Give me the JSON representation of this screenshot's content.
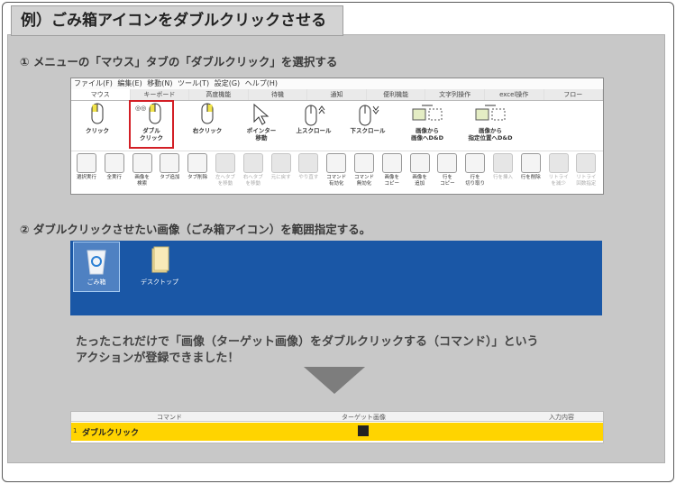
{
  "heading": "例）ごみ箱アイコンをダブルクリックさせる",
  "step1": "① メニューの「マウス」タブの「ダブルクリック」を選択する",
  "step2": "② ダブルクリックさせたい画像（ごみ箱アイコン）を範囲指定する。",
  "menubar": [
    "ファイル(F)",
    "編集(E)",
    "移動(N)",
    "ツール(T)",
    "設定(G)",
    "ヘルプ(H)"
  ],
  "tabs": [
    "マウス",
    "キーボード",
    "高度機能",
    "待機",
    "通知",
    "便利機能",
    "文字列操作",
    "excel操作",
    "フロー"
  ],
  "mouse_tools": [
    {
      "label": "クリック"
    },
    {
      "label": "ダブル\nクリック"
    },
    {
      "label": "右クリック"
    },
    {
      "label": "ポインター\n移動"
    },
    {
      "label": "上スクロール"
    },
    {
      "label": "下スクロール"
    },
    {
      "label": "画像から\n画像へD&D"
    },
    {
      "label": "画像から\n指定位置へD&D"
    }
  ],
  "toolbar2": [
    {
      "label": "選択実行",
      "disabled": false
    },
    {
      "label": "全実行",
      "disabled": false
    },
    {
      "label": "画像を\n検索",
      "disabled": false
    },
    {
      "label": "タブ追加",
      "disabled": false
    },
    {
      "label": "タブ削除",
      "disabled": false
    },
    {
      "label": "左へタブ\nを移動",
      "disabled": true
    },
    {
      "label": "右へタブ\nを移動",
      "disabled": true
    },
    {
      "label": "元に戻す",
      "disabled": true
    },
    {
      "label": "やり直す",
      "disabled": true
    },
    {
      "label": "コマンド\n有効化",
      "disabled": false
    },
    {
      "label": "コマンド\n無効化",
      "disabled": false
    },
    {
      "label": "画像を\nコピー",
      "disabled": false
    },
    {
      "label": "画像を\n追加",
      "disabled": false
    },
    {
      "label": "行を\nコピー",
      "disabled": false
    },
    {
      "label": "行を\n切り取り",
      "disabled": false
    },
    {
      "label": "行を挿入",
      "disabled": true
    },
    {
      "label": "行を削除",
      "disabled": false
    },
    {
      "label": "リトライ\nを減少",
      "disabled": true
    },
    {
      "label": "リトライ\n回数指定",
      "disabled": true
    }
  ],
  "desktop": {
    "recycle_bin": "ごみ箱",
    "desktop_folder": "デスクトップ"
  },
  "caption_line1": "たったこれだけで「画像（ターゲット画像）をダブルクリックする（コマンド）」という",
  "caption_line2": "アクションが登録できました！",
  "table": {
    "headers": [
      "コマンド",
      "ターゲット画像",
      "入力内容"
    ],
    "row_number": "1",
    "row_command": "ダブルクリック"
  },
  "colors": {
    "highlight": "#d31f26",
    "desktop_blue": "#1a57a6",
    "row_yellow": "#ffd400"
  }
}
